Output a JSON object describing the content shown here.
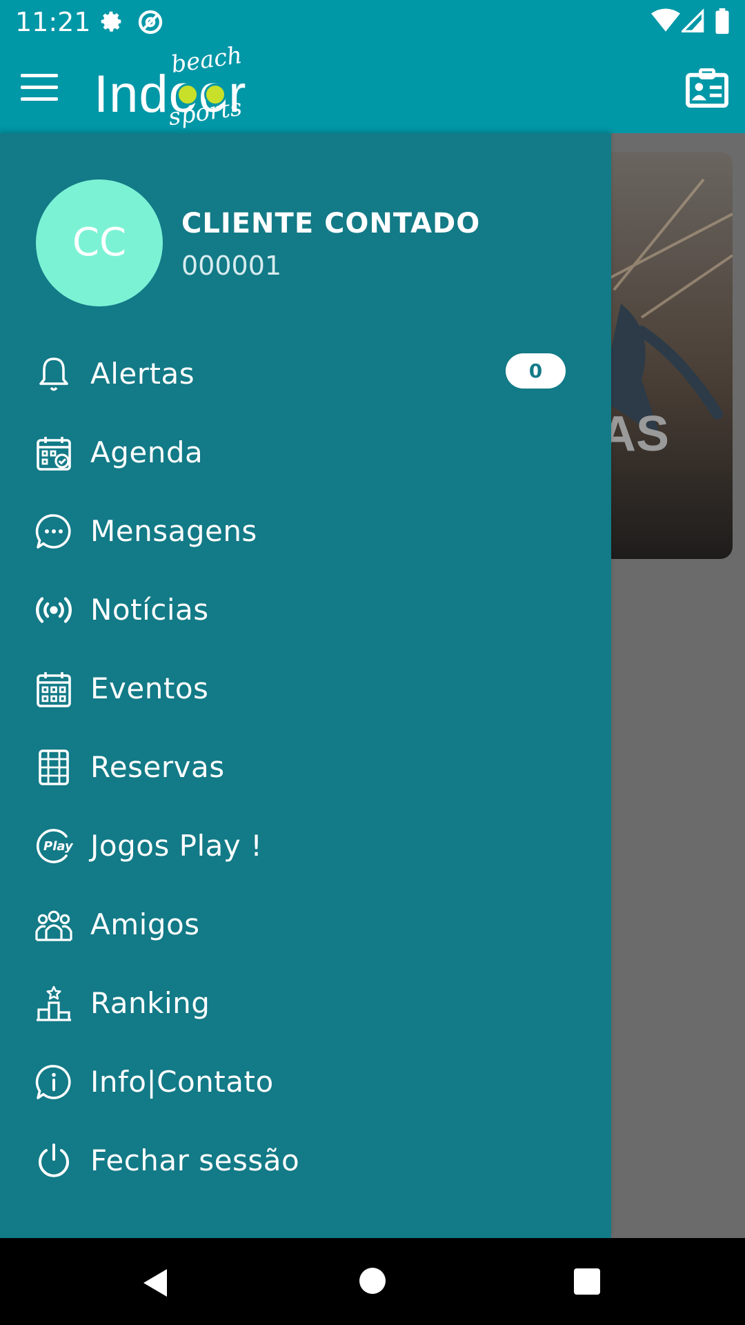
{
  "status_bar": {
    "time": "11:21",
    "icons": [
      "gear-icon",
      "at-sign-icon",
      "wifi-icon",
      "signal-icon",
      "battery-icon"
    ]
  },
  "app_bar": {
    "logo": {
      "main": "Indoor",
      "top": "beach",
      "bottom": "sports"
    },
    "left_icon": "hamburger-menu-icon",
    "right_icon": "id-card-icon",
    "color": "#0097a7"
  },
  "background": {
    "card_text": "AS"
  },
  "drawer": {
    "color": "#137a87",
    "user": {
      "initials": "CC",
      "name": "CLIENTE CONTADO",
      "code": "000001",
      "avatar_color": "#7cf2d5"
    },
    "items": [
      {
        "label": "Alertas",
        "icon": "bell-icon",
        "badge": "0"
      },
      {
        "label": "Agenda",
        "icon": "calendar-check-icon"
      },
      {
        "label": "Mensagens",
        "icon": "chat-bubble-icon"
      },
      {
        "label": "Notícias",
        "icon": "broadcast-icon"
      },
      {
        "label": "Eventos",
        "icon": "calendar-grid-icon"
      },
      {
        "label": "Reservas",
        "icon": "court-icon"
      },
      {
        "label": "Jogos Play !",
        "icon": "play-logo-icon"
      },
      {
        "label": "Amigos",
        "icon": "group-icon"
      },
      {
        "label": "Ranking",
        "icon": "podium-icon"
      },
      {
        "label": "Info|Contato",
        "icon": "info-bubble-icon"
      },
      {
        "label": "Fechar sessão",
        "icon": "power-icon"
      }
    ]
  },
  "nav_bar": {
    "icons": [
      "back-icon",
      "home-icon",
      "recents-icon"
    ]
  }
}
